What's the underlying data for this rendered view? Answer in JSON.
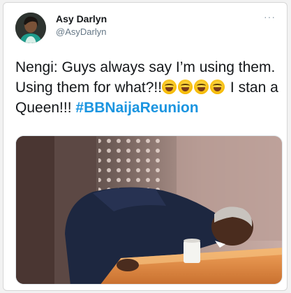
{
  "tweet": {
    "author_name": "Asy Darlyn",
    "author_handle": "@AsyDarlyn",
    "more_glyph": "···",
    "text_part1": "Nengi: Guys always say I’m using them. Using them for what?!!",
    "text_part2": " I stan a Queen!!! ",
    "hashtag": "#BBNaijaReunion",
    "emoji_name": "face-with-tears-of-joy-icon",
    "emoji_count": 4
  },
  "colors": {
    "hashtag": "#1b95e0",
    "name": "#14171a",
    "handle": "#657786"
  }
}
